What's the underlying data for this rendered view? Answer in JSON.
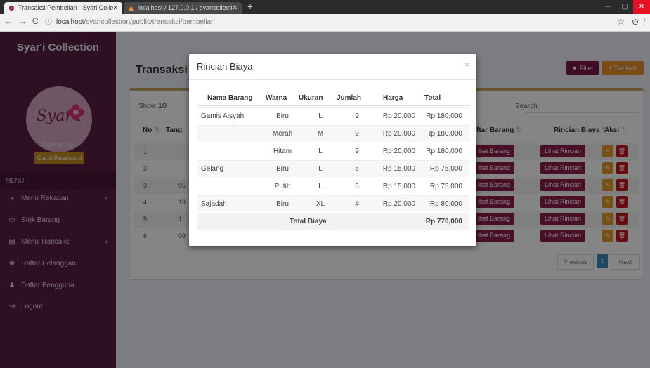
{
  "browser": {
    "tabs": [
      {
        "title": "Transaksi Pembelian - Syari Colle",
        "active": true
      },
      {
        "title": "localhost / 127.0.0.1 / syaricollecti",
        "active": false
      }
    ],
    "url_host": "localhost",
    "url_path": "/syaricollection/public/transaksi/pembelian"
  },
  "sidebar": {
    "brand": "Syar'i Collection",
    "logo_text": "Syar'i",
    "username": "Nahriputra",
    "change_password_label": "Ganti Password",
    "menu_header": "MENU",
    "items": [
      {
        "label": "Menu Rekapan",
        "icon": "dashboard-icon",
        "has_submenu": true
      },
      {
        "label": "Stok Barang",
        "icon": "laptop-icon",
        "has_submenu": false
      },
      {
        "label": "Menu Transaksi",
        "icon": "file-icon",
        "has_submenu": true
      },
      {
        "label": "Daftar Pelanggan",
        "icon": "users-icon",
        "has_submenu": false
      },
      {
        "label": "Daftar Pengguna",
        "icon": "user-icon",
        "has_submenu": false
      },
      {
        "label": "Logout",
        "icon": "sign-out-icon",
        "has_submenu": false
      }
    ]
  },
  "page": {
    "title": "Transaksi",
    "filter_label": "Filter",
    "add_label": "Tambah",
    "show_label": "Show",
    "show_value": "10",
    "search_label": "Search:",
    "columns": {
      "no": "No",
      "date_partial": "Tang",
      "daftar_barang": "ftar Barang",
      "rincian_biaya": "Rincian Biaya",
      "aksi": "Aksi"
    },
    "rows": [
      {
        "no": "1",
        "date": ""
      },
      {
        "no": "2",
        "date": ""
      },
      {
        "no": "3",
        "date": "05"
      },
      {
        "no": "4",
        "date": "19"
      },
      {
        "no": "5",
        "date": "1"
      },
      {
        "no": "6",
        "date": "09"
      }
    ],
    "lihat_barang_label": "ihat Barang",
    "lihat_rincian_label": "Lihat Rincian",
    "pagination": {
      "previous": "Previous",
      "current": "1",
      "next": "Next"
    }
  },
  "modal": {
    "title": "Rincian Biaya",
    "close": "×",
    "headers": [
      "Nama Barang",
      "Warna",
      "Ukuran",
      "Jumlah",
      "Harga",
      "Total"
    ],
    "rows": [
      {
        "nama": "Gamis Aisyah",
        "warna": "Biru",
        "ukuran": "L",
        "jumlah": "9",
        "harga": "Rp 20,000",
        "total": "Rp 180,000"
      },
      {
        "nama": "",
        "warna": "Merah",
        "ukuran": "M",
        "jumlah": "9",
        "harga": "Rp 20,000",
        "total": "Rp 180,000"
      },
      {
        "nama": "",
        "warna": "Hitam",
        "ukuran": "L",
        "jumlah": "9",
        "harga": "Rp 20,000",
        "total": "Rp 180,000"
      },
      {
        "nama": "Gelang",
        "warna": "Biru",
        "ukuran": "L",
        "jumlah": "5",
        "harga": "Rp 15,000",
        "total": "Rp 75,000"
      },
      {
        "nama": "",
        "warna": "Putih",
        "ukuran": "L",
        "jumlah": "5",
        "harga": "Rp 15,000",
        "total": "Rp 75,000"
      },
      {
        "nama": "Sajadah",
        "warna": "Biru",
        "ukuran": "XL",
        "jumlah": "4",
        "harga": "Rp 20,000",
        "total": "Rp 80,000"
      }
    ],
    "total_label": "Total Biaya",
    "total_value": "Rp 770,000"
  },
  "colors": {
    "sidebar": "#5b1d44",
    "accent_button": "#8c1d4a",
    "add_button": "#e8902c",
    "edit_button": "#e39a28",
    "delete_button": "#c9141b"
  }
}
